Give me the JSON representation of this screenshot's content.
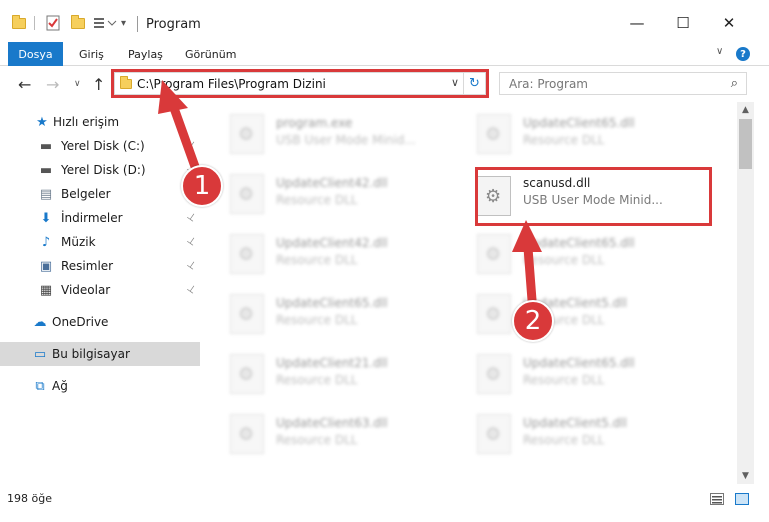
{
  "window": {
    "title": "Program",
    "minimize": "—",
    "maximize": "☐",
    "close": "✕"
  },
  "ribbon": {
    "tabs": [
      "Dosya",
      "Giriş",
      "Paylaş",
      "Görünüm"
    ],
    "help": "?",
    "expand": "∨"
  },
  "nav": {
    "back": "←",
    "forward": "→",
    "recent": "∨",
    "up": "↑",
    "address": "C:\\Program Files\\Program Dizini",
    "address_dropdown": "∨",
    "refresh": "↻",
    "search_placeholder": "Ara: Program",
    "search_icon": "⌕"
  },
  "sidebar": {
    "items": [
      {
        "label": "Hızlı erişim",
        "icon": "star-icon",
        "glyph": "★",
        "color": "#1979ca",
        "pinned": false
      },
      {
        "label": "Yerel Disk (C:)",
        "icon": "drive-icon",
        "glyph": "▬",
        "color": "#555555",
        "pinned": true
      },
      {
        "label": "Yerel Disk (D:)",
        "icon": "drive-icon",
        "glyph": "▬",
        "color": "#555555",
        "pinned": true
      },
      {
        "label": "Belgeler",
        "icon": "documents-icon",
        "glyph": "▤",
        "color": "#6f7f8f",
        "pinned": true
      },
      {
        "label": "İndirmeler",
        "icon": "download-icon",
        "glyph": "⬇",
        "color": "#1979ca",
        "pinned": true
      },
      {
        "label": "Müzik",
        "icon": "music-icon",
        "glyph": "♪",
        "color": "#1979ca",
        "pinned": true
      },
      {
        "label": "Resimler",
        "icon": "pictures-icon",
        "glyph": "▣",
        "color": "#4a6f9a",
        "pinned": true
      },
      {
        "label": "Videolar",
        "icon": "video-icon",
        "glyph": "▦",
        "color": "#444444",
        "pinned": true
      },
      {
        "label": "OneDrive",
        "icon": "cloud-icon",
        "glyph": "☁",
        "color": "#1979ca",
        "pinned": false
      },
      {
        "label": "Bu bilgisayar",
        "icon": "computer-icon",
        "glyph": "▭",
        "color": "#1979ca",
        "pinned": false,
        "selected": true
      },
      {
        "label": "Ağ",
        "icon": "network-icon",
        "glyph": "⧉",
        "color": "#1979ca",
        "pinned": false
      }
    ],
    "pin_glyph": "📌"
  },
  "files": {
    "left": [
      {
        "name": "program.exe",
        "desc": "USB User Mode Minid..."
      },
      {
        "name": "UpdateClient42.dll",
        "desc": "Resource DLL"
      },
      {
        "name": "UpdateClient42.dll",
        "desc": "Resource DLL"
      },
      {
        "name": "UpdateClient65.dll",
        "desc": "Resource DLL"
      },
      {
        "name": "UpdateClient21.dll",
        "desc": "Resource DLL"
      },
      {
        "name": "UpdateClient63.dll",
        "desc": "Resource DLL"
      }
    ],
    "right": [
      {
        "name": "UpdateClient65.dll",
        "desc": "Resource DLL"
      },
      {
        "name": "scanusd.dll",
        "desc": "USB User Mode Minid...",
        "highlighted": true
      },
      {
        "name": "UpdateClient65.dll",
        "desc": "Resource DLL"
      },
      {
        "name": "UpdateClient5.dll",
        "desc": "Resource DLL"
      },
      {
        "name": "UpdateClient65.dll",
        "desc": "Resource DLL"
      },
      {
        "name": "UpdateClient5.dll",
        "desc": "Resource DLL"
      }
    ]
  },
  "status": {
    "count": "198 öğe"
  },
  "annotations": {
    "marker1": "1",
    "marker2": "2",
    "color": "#d9393a"
  }
}
